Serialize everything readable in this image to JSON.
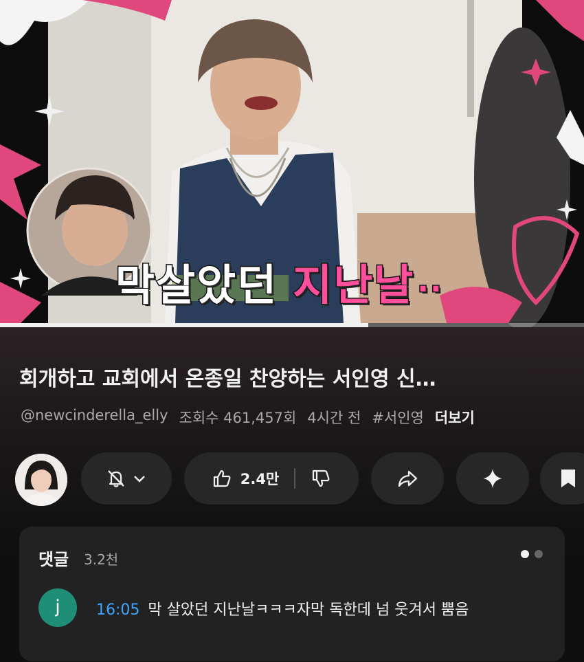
{
  "video": {
    "caption_white": "막살았던",
    "caption_pink": "지난날",
    "caption_dots": "..",
    "progress_fraction": 0.63
  },
  "info": {
    "title": "회개하고 교회에서 온종일 찬양하는 서인영 신…",
    "channel": "@newcinderella_elly",
    "views": "조회수 461,457회",
    "age": "4시간 전",
    "hashtag": "#서인영",
    "more": "더보기"
  },
  "actions": {
    "like_count": "2.4만",
    "icons": [
      "bell-off-icon",
      "chevron-down-icon",
      "thumbs-up-icon",
      "thumbs-down-icon",
      "share-icon",
      "sparkle-icon",
      "bookmark-icon"
    ]
  },
  "comments": {
    "title": "댓글",
    "count": "3.2천",
    "top_comment": {
      "avatar_letter": "j",
      "timestamp": "16:05",
      "text": "막 살았던 지난날ㅋㅋㅋ자막 독한데 넘 웃겨서 뿜음"
    }
  },
  "colors": {
    "accent_pink": "#ff4f9a",
    "timestamp_blue": "#3ea6ff",
    "avatar_green": "#1e8f76",
    "pill_bg": "#272727"
  }
}
